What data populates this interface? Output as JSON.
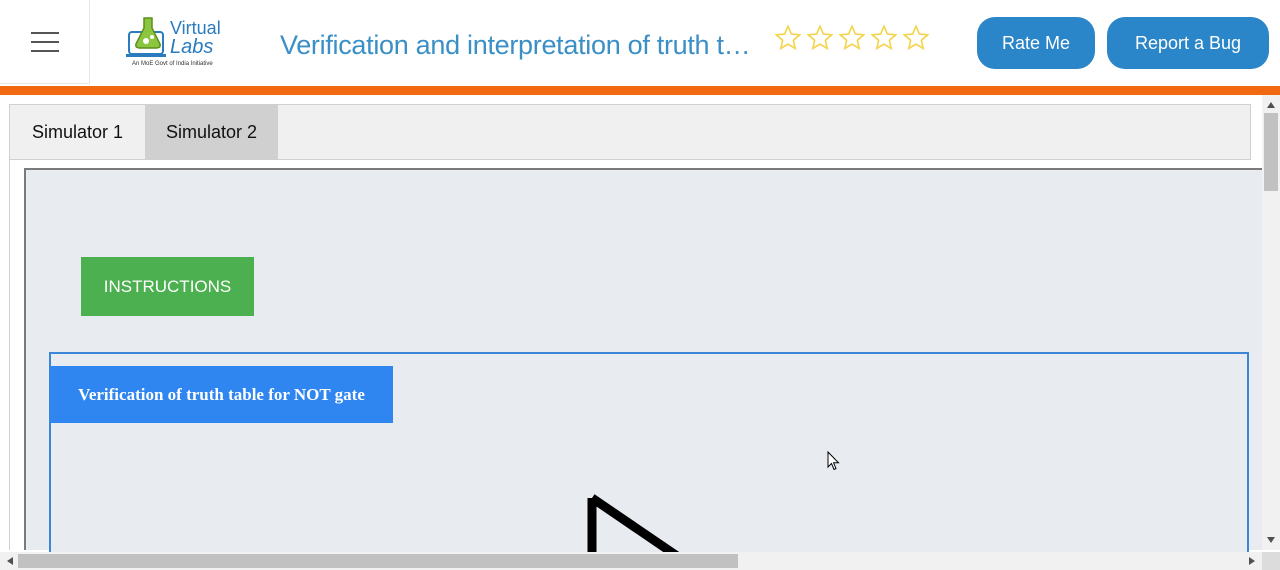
{
  "header": {
    "logo": {
      "line1": "Virtual",
      "line2": "Labs",
      "tagline": "An MoE Govt of India Initiative"
    },
    "experiment_title": "Verification and interpretation of truth table for AND, OR, NOT, NAND, NOR, Ex-OR, Ex-NOR gates",
    "rating": {
      "stars_total": 5,
      "stars_filled": 0,
      "star_color": "#f2d44a"
    },
    "rate_button": "Rate Me",
    "bug_button": "Report a Bug",
    "accent_color": "#f16a12",
    "button_color": "#2a86c9"
  },
  "tabs": [
    {
      "label": "Simulator 1",
      "active": false
    },
    {
      "label": "Simulator 2",
      "active": true
    }
  ],
  "simulator": {
    "instructions_button": "INSTRUCTIONS",
    "heading": "Verification of truth table for NOT gate",
    "instructions_color": "#4caf50",
    "heading_color": "#2f86f0"
  }
}
